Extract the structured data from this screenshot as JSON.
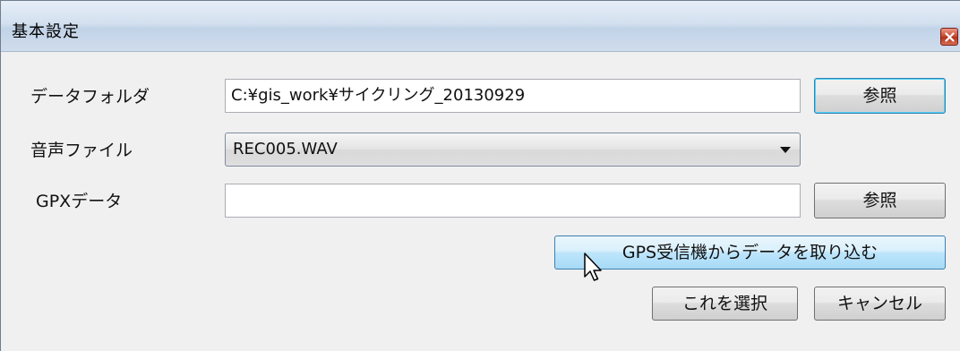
{
  "window": {
    "title": "基本設定"
  },
  "form": {
    "data_folder": {
      "label": "データフォルダ",
      "value": "C:¥gis_work¥サイクリング_20130929",
      "browse_label": "参照"
    },
    "audio_file": {
      "label": "音声ファイル",
      "selected": "REC005.WAV"
    },
    "gpx_data": {
      "label": "GPXデータ",
      "value": "",
      "browse_label": "参照"
    }
  },
  "buttons": {
    "import_gps": "GPS受信機からデータを取り込む",
    "select": "これを選択",
    "cancel": "キャンセル"
  },
  "icons": {
    "close": "close-icon",
    "cursor": "mouse-pointer-icon"
  },
  "colors": {
    "title_bar": "#cfdcec",
    "close_button": "#c7452e",
    "hover_button": "#bee6fd",
    "default_button_border": "#3c7fb1"
  }
}
